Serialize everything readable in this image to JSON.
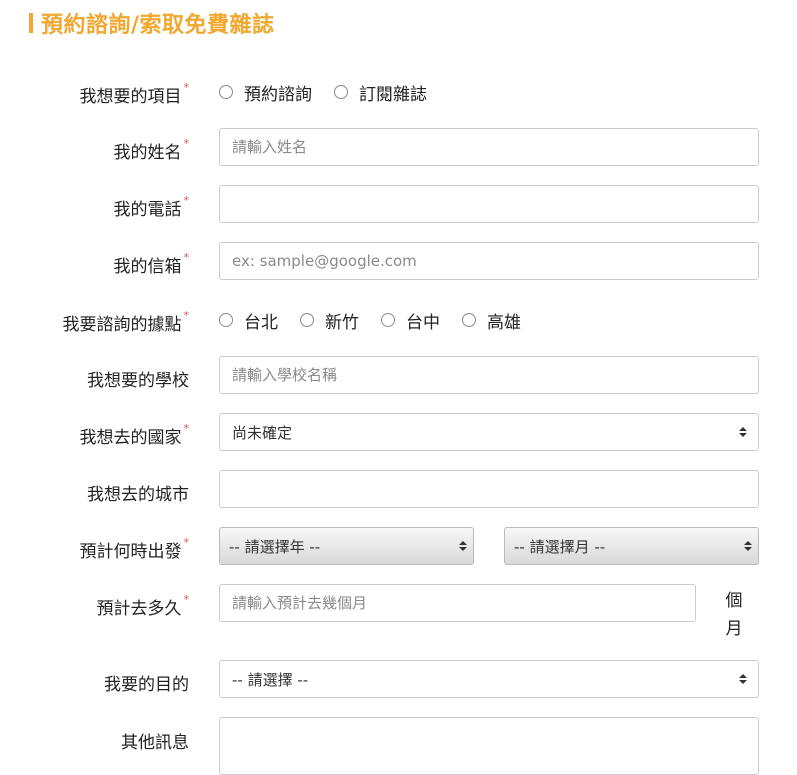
{
  "header": {
    "title": "預約諮詢/索取免費雜誌"
  },
  "form": {
    "item": {
      "label": "我想要的項目",
      "req": "*",
      "options": [
        "預約諮詢",
        "訂閱雜誌"
      ]
    },
    "name": {
      "label": "我的姓名",
      "req": "*",
      "placeholder": "請輸入姓名"
    },
    "phone": {
      "label": "我的電話",
      "req": "*",
      "placeholder": ""
    },
    "email": {
      "label": "我的信箱",
      "req": "*",
      "placeholder": "ex: sample@google.com"
    },
    "branch": {
      "label": "我要諮詢的據點",
      "req": "*",
      "options": [
        "台北",
        "新竹",
        "台中",
        "高雄"
      ]
    },
    "school": {
      "label": "我想要的學校",
      "placeholder": "請輸入學校名稱"
    },
    "country": {
      "label": "我想去的國家",
      "req": "*",
      "selected": "尚未確定"
    },
    "city": {
      "label": "我想去的城市",
      "placeholder": ""
    },
    "depart": {
      "label": "預計何時出發",
      "req": "*",
      "year": "-- 請選擇年 --",
      "month": "-- 請選擇月 --"
    },
    "duration": {
      "label": "預計去多久",
      "req": "*",
      "placeholder": "請輸入預計去幾個月",
      "unit_1": "個",
      "unit_2": "月"
    },
    "purpose": {
      "label": "我要的目的",
      "selected": "-- 請選擇 --"
    },
    "message": {
      "label": "其他訊息"
    }
  },
  "colors": {
    "accent": "#f0a830",
    "required": "#d9534f",
    "border": "#cccccc"
  }
}
